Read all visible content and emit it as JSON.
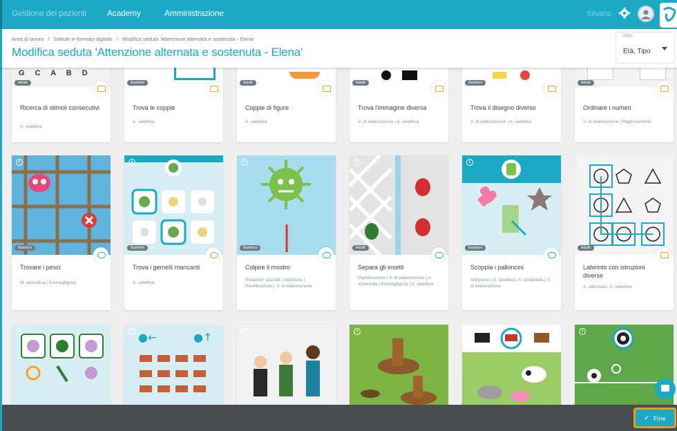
{
  "topbar": {
    "nav": [
      "Gestione dei pazienti",
      "Academy",
      "Amministrazione"
    ],
    "user_name": "Silvano"
  },
  "header": {
    "breadcrumb": [
      "Area di lavoro",
      "/",
      "Sedute in formato digitale",
      "/",
      "Modifica seduta 'Attenzione alternata e sostenuta - Elena'"
    ],
    "title": "Modifica seduta 'Attenzione alternata e sostenuta - Elena'",
    "filter": {
      "label": "Filtri",
      "value": "Età, Tipo"
    }
  },
  "rows": [
    [
      {
        "badge": "Adulti",
        "name": "Ricerca di stimoli consecutivi",
        "tags": "A. selettiva",
        "icon": "orange"
      },
      {
        "badge": "Bambini",
        "name": "Trova le coppie",
        "tags": "A. selettiva",
        "icon": "orange"
      },
      {
        "badge": "Adulti",
        "name": "Coppie di figure",
        "tags": "A. selettiva",
        "icon": "orange"
      },
      {
        "badge": "Adulti",
        "name": "Trova l'immagine diversa",
        "tags": "V. di elaborazione | A. selettiva",
        "icon": "orange"
      },
      {
        "badge": "Bambini",
        "name": "Trova il disegno diverso",
        "tags": "V. di elaborazione | A. selettiva",
        "icon": "orange"
      },
      {
        "badge": "Adulti",
        "name": "Ordinare i numeri",
        "tags": "V. di elaborazione | Ragionamento",
        "icon": "orange"
      }
    ],
    [
      {
        "badge": "Bambini",
        "name": "Trovare i pesci",
        "tags": "M. episodica | Emineglignza",
        "icon": "blue"
      },
      {
        "badge": "Bambini",
        "name": "Trova i gemelli mancanti",
        "tags": "A. selettiva",
        "icon": "green"
      },
      {
        "badge": "Bambini",
        "name": "Colpire il mostro",
        "tags": "Relazioni spaziali | Inibizione | Pianificazione | V. di elaborazione",
        "icon": "blue"
      },
      {
        "badge": "Adulti",
        "name": "Separa gli insetti",
        "tags": "Pianificazione | V. di elaborazione | A. sostenuta | Emineglignza | A. selettiva",
        "icon": "blue"
      },
      {
        "badge": "Bambini",
        "name": "Scoppia i palloncini",
        "tags": "Inibizione | A. selettiva | A. sostenuta | V. di elaborazione",
        "icon": "blue"
      },
      {
        "badge": "Adulti",
        "name": "Labirinto con istruzioni diverse",
        "tags": "A. alternata | A. selettiva",
        "icon": "orange"
      }
    ]
  ],
  "footer": {
    "fine_label": "Fine"
  },
  "colors": {
    "accent": "#1ba9c6",
    "highlight": "#f29a1a",
    "footer": "#4a4d4f"
  },
  "icons": [
    "gear-icon",
    "avatar-icon",
    "logo-icon",
    "info-icon",
    "calendar-icon",
    "gamepad-icon",
    "chat-icon",
    "check-icon"
  ]
}
